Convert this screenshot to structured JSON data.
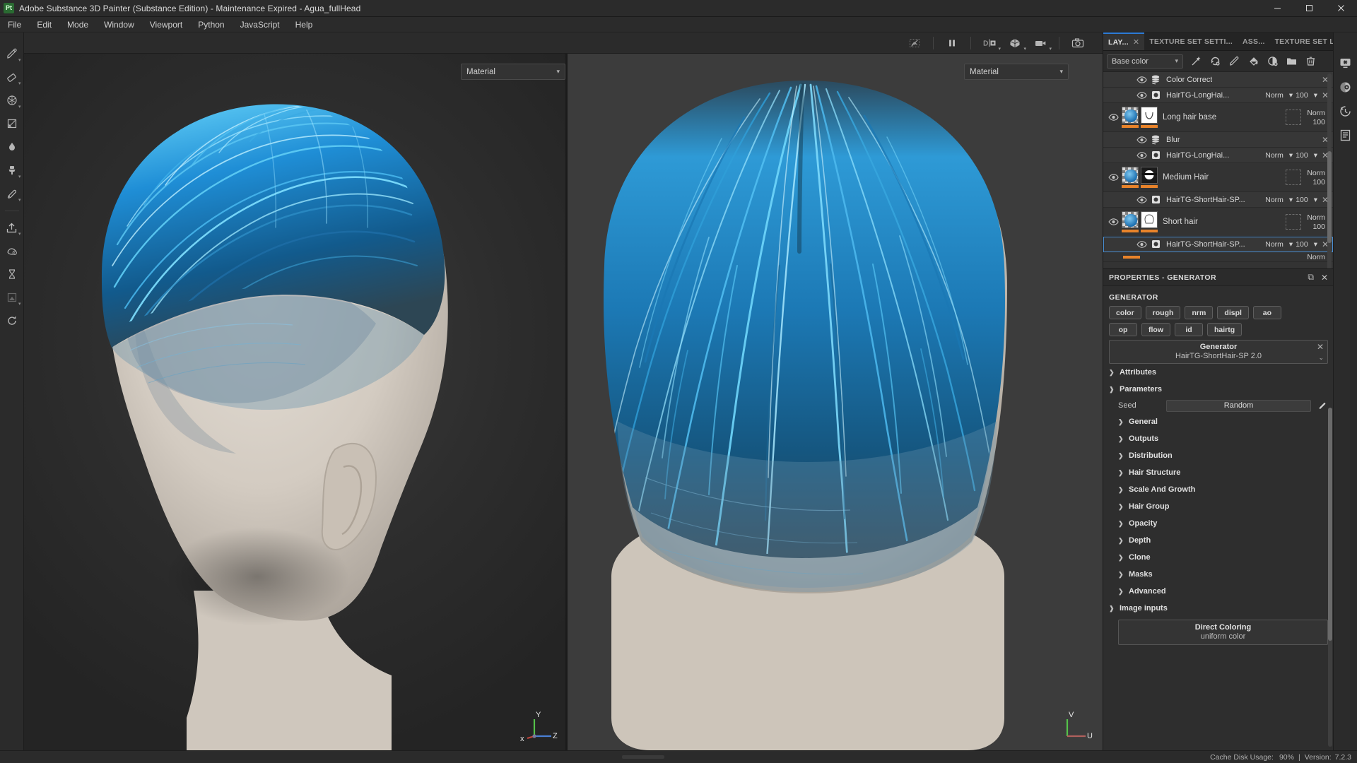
{
  "titlebar": {
    "logo": "Pt",
    "title": "Adobe Substance 3D Painter (Substance Edition) - Maintenance Expired - Agua_fullHead",
    "minimize": "–",
    "maximize": "❐",
    "close": "✕"
  },
  "menubar": {
    "items": [
      {
        "label": "File"
      },
      {
        "label": "Edit"
      },
      {
        "label": "Mode"
      },
      {
        "label": "Window"
      },
      {
        "label": "Viewport"
      },
      {
        "label": "Python"
      },
      {
        "label": "JavaScript"
      },
      {
        "label": "Help"
      }
    ]
  },
  "left_toolbar": {
    "tools": [
      {
        "name": "paint-brush-icon",
        "label": "Paint"
      },
      {
        "name": "eraser-icon",
        "label": "Eraser"
      },
      {
        "name": "projection-icon",
        "label": "Projection"
      },
      {
        "name": "polygon-fill-icon",
        "label": "Polygon Fill"
      },
      {
        "name": "smudge-icon",
        "label": "Smudge"
      },
      {
        "name": "clone-stamp-icon",
        "label": "Clone Stamp"
      },
      {
        "name": "color-picker-icon",
        "label": "Material Picker"
      },
      {
        "name": "export-icon",
        "label": "Export Textures"
      },
      {
        "name": "bake-icon",
        "label": "Bake Mesh Maps"
      },
      {
        "name": "hourglass-icon",
        "label": "Compute"
      },
      {
        "name": "render-icon",
        "label": "Iray Render"
      },
      {
        "name": "refresh-icon",
        "label": "Refresh"
      }
    ]
  },
  "viewport": {
    "toolbar_buttons": [
      {
        "name": "toggle-hide-icon",
        "label": "Hide"
      },
      {
        "name": "pause-engine-icon",
        "label": "Pause Engine"
      },
      {
        "name": "display-mode-icon",
        "label": "Display Mode"
      },
      {
        "name": "shading-mode-icon",
        "label": "Shading"
      },
      {
        "name": "camera-mode-icon",
        "label": "Camera"
      },
      {
        "name": "screenshot-icon",
        "label": "Screenshot"
      }
    ],
    "left_pane": {
      "channel_dropdown": "Material",
      "gizmo": {
        "x": "x",
        "y": "Y",
        "z": "Z"
      }
    },
    "right_pane": {
      "channel_dropdown": "Material",
      "gizmo": {
        "u": "U",
        "v": "V"
      }
    }
  },
  "right_dock": {
    "tabs": [
      {
        "label": "LAY...",
        "active": true,
        "closable": true
      },
      {
        "label": "TEXTURE SET SETTI...",
        "active": false
      },
      {
        "label": "ASS...",
        "active": false
      },
      {
        "label": "TEXTURE SET L...",
        "active": false
      }
    ],
    "layer_toolbar": {
      "channel": "Base color",
      "buttons": [
        {
          "name": "add-effect-icon",
          "label": "Add effect"
        },
        {
          "name": "add-fill-layer-icon",
          "label": "Add fill layer"
        },
        {
          "name": "add-paint-layer-icon",
          "label": "Add paint layer"
        },
        {
          "name": "add-fill-icon",
          "label": "Add fill"
        },
        {
          "name": "add-mask-icon",
          "label": "Add mask"
        },
        {
          "name": "add-folder-icon",
          "label": "Add folder"
        },
        {
          "name": "delete-layer-icon",
          "label": "Delete layer"
        }
      ]
    },
    "layers": [
      {
        "kind": "effect",
        "name": "Color Correct",
        "icon": "filter-icon",
        "visible": true,
        "blend": null,
        "opacity": null,
        "close": "✕",
        "selected": false
      },
      {
        "kind": "effect",
        "name": "HairTG-LongHai...",
        "icon": "generator-icon",
        "visible": true,
        "blend": "Norm",
        "opacity": "100",
        "close": "✕",
        "selected": false
      },
      {
        "kind": "stack",
        "name": "Long hair base",
        "visible": true,
        "blend": "Norm",
        "opacity": "100",
        "has_mask_slot": true,
        "selected": false,
        "mask_shape": "curve"
      },
      {
        "kind": "effect",
        "name": "Blur",
        "icon": "filter-icon",
        "visible": true,
        "blend": null,
        "opacity": null,
        "close": "✕",
        "selected": false
      },
      {
        "kind": "effect",
        "name": "HairTG-LongHai...",
        "icon": "generator-icon",
        "visible": true,
        "blend": "Norm",
        "opacity": "100",
        "close": "✕",
        "selected": false
      },
      {
        "kind": "stack",
        "name": "Medium Hair",
        "visible": true,
        "blend": "Norm",
        "opacity": "100",
        "has_mask_slot": true,
        "selected": false,
        "mask_shape": "medium"
      },
      {
        "kind": "effect",
        "name": "HairTG-ShortHair-SP...",
        "icon": "generator-icon",
        "visible": true,
        "blend": "Norm",
        "opacity": "100",
        "close": "✕",
        "selected": false
      },
      {
        "kind": "stack",
        "name": "Short hair",
        "visible": true,
        "blend": "Norm",
        "opacity": "100",
        "has_mask_slot": true,
        "selected": false,
        "mask_shape": "short"
      },
      {
        "kind": "effect",
        "name": "HairTG-ShortHair-SP...",
        "icon": "generator-icon",
        "visible": true,
        "blend": "Norm",
        "opacity": "100",
        "close": "✕",
        "selected": true
      }
    ],
    "partial_row_blend": "Norm"
  },
  "properties": {
    "header_title": "PROPERTIES - GENERATOR",
    "header_dock_icon": "⧉",
    "header_close_icon": "✕",
    "section_title": "GENERATOR",
    "channel_chips_row1": [
      {
        "label": "color"
      },
      {
        "label": "rough"
      },
      {
        "label": "nrm"
      },
      {
        "label": "displ"
      },
      {
        "label": "ao"
      }
    ],
    "channel_chips_row2": [
      {
        "label": "op"
      },
      {
        "label": "flow"
      },
      {
        "label": "id"
      },
      {
        "label": "hairtg"
      }
    ],
    "generator": {
      "label": "Generator",
      "value": "HairTG-ShortHair-SP 2.0",
      "close_icon": "✕",
      "caret_icon": "⌄"
    },
    "accordions": [
      {
        "label": "Attributes",
        "expanded": false,
        "indent": false
      },
      {
        "label": "Parameters",
        "expanded": true,
        "indent": false
      }
    ],
    "seed": {
      "label": "Seed",
      "value": "Random",
      "edit_icon": "pencil-icon"
    },
    "parameter_groups": [
      {
        "label": "General",
        "expanded": false
      },
      {
        "label": "Outputs",
        "expanded": false
      },
      {
        "label": "Distribution",
        "expanded": false
      },
      {
        "label": "Hair Structure",
        "expanded": false
      },
      {
        "label": "Scale And Growth",
        "expanded": false
      },
      {
        "label": "Hair Group",
        "expanded": false
      },
      {
        "label": "Opacity",
        "expanded": false
      },
      {
        "label": "Depth",
        "expanded": false
      },
      {
        "label": "Clone",
        "expanded": false
      },
      {
        "label": "Masks",
        "expanded": false
      },
      {
        "label": "Advanced",
        "expanded": false
      }
    ],
    "image_inputs": {
      "label": "Image inputs",
      "expanded": true,
      "items": [
        {
          "title": "Direct Coloring",
          "value": "uniform color"
        }
      ]
    }
  },
  "far_right_bar": {
    "items": [
      {
        "name": "display-settings-icon",
        "label": "Display settings"
      },
      {
        "name": "shader-settings-icon",
        "label": "Shader settings"
      },
      {
        "name": "history-icon",
        "label": "History"
      },
      {
        "name": "log-icon",
        "label": "Log"
      }
    ]
  },
  "statusbar": {
    "cache_label": "Cache Disk Usage:",
    "cache_value": "90%",
    "separator": "|",
    "version_label": "Version:",
    "version_value": "7.2.3"
  },
  "colors": {
    "accent": "#2d7bd6",
    "selection": "#4a8fd4",
    "mask_bar": "#e8832a",
    "panel_bg": "#2b2b2b",
    "list_bg": "#333333",
    "hair_blue": "#1c6fb0"
  }
}
